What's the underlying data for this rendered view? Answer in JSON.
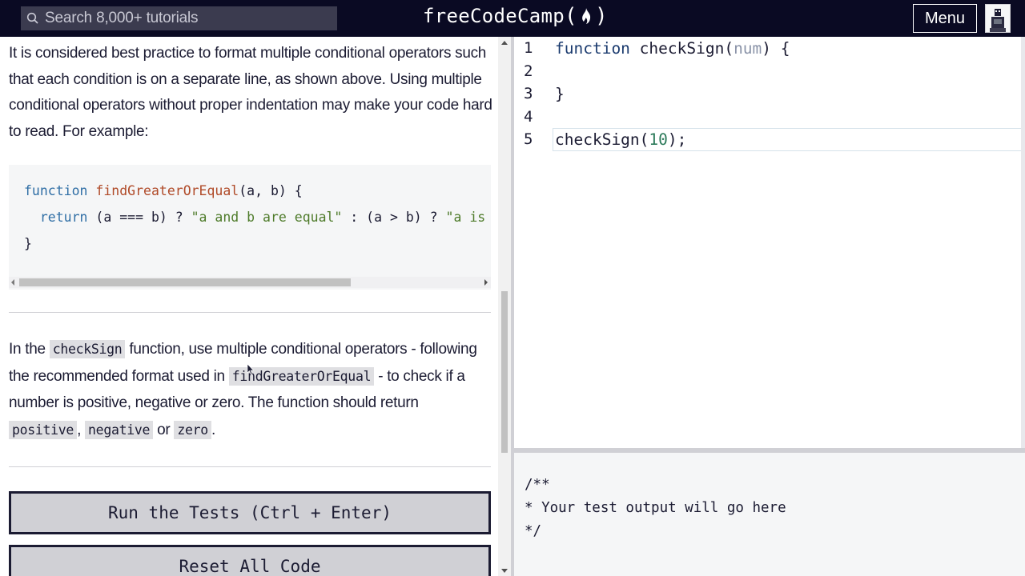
{
  "navbar": {
    "search_placeholder": "Search 8,000+ tutorials",
    "brand_text": "freeCodeCamp",
    "brand_paren_open": "(",
    "brand_paren_close": ")",
    "menu_label": "Menu",
    "search_icon": "search-icon",
    "flame_icon": "flame-icon",
    "avatar_icon": "user-avatar-icon"
  },
  "description": {
    "paragraph1": "It is considered best practice to format multiple conditional operators such that each condition is on a separate line, as shown above. Using multiple conditional operators without proper indentation may make your code hard to read. For example:",
    "example_code": {
      "line1_kw": "function",
      "line1_fn": "findGreaterOrEqual",
      "line1_rest": "(a, b) {",
      "line2_kw": "return",
      "line2_a": " (a === b) ? ",
      "line2_str1": "\"a and b are equal\"",
      "line2_b": " : (a > b) ? ",
      "line2_str2": "\"a is gre",
      "line3": "}"
    },
    "p2_part1": "In the ",
    "p2_code1": "checkSign",
    "p2_part2": " function, use multiple conditional operators - following the recommended format used in ",
    "p2_code2": "findGreaterOrEqual",
    "p2_part3": " - to check if a number is positive, negative or zero. The function should return ",
    "p2_code3": "positive",
    "p2_sep1": ", ",
    "p2_code4": "negative",
    "p2_sep2": " or ",
    "p2_code5": "zero",
    "p2_end": "."
  },
  "buttons": {
    "run_tests": "Run the Tests (Ctrl + Enter)",
    "reset_code": "Reset All Code"
  },
  "editor": {
    "line_numbers": [
      "1",
      "2",
      "3",
      "4",
      "5"
    ],
    "line1_kw": "function",
    "line1_fn": " checkSign(",
    "line1_param": "num",
    "line1_end": ") {",
    "line3": "}",
    "line5_fn": "checkSign(",
    "line5_num": "10",
    "line5_end": ");"
  },
  "output": {
    "line1": "/**",
    "line2": "* Your test output will go here",
    "line3": "*/"
  },
  "colors": {
    "navbar_bg": "#0a0a23",
    "button_bg": "#d0d0d5",
    "code_bg": "#f5f6f7"
  }
}
